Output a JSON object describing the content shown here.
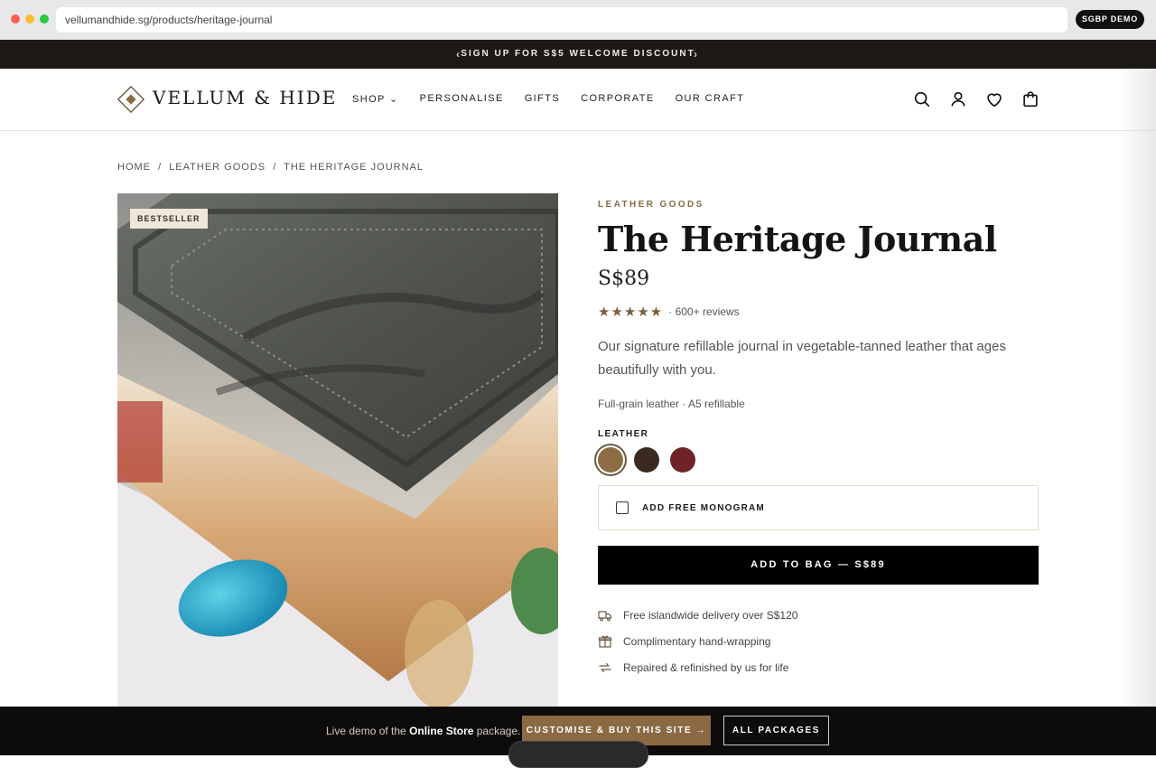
{
  "browser": {
    "url": "vellumandhide.sg/products/heritage-journal",
    "demo_badge": "SGBP DEMO"
  },
  "announcement": {
    "prev_arrow": "‹",
    "message": "SIGN UP FOR S$5 WELCOME DISCOUNT",
    "next_arrow": "›"
  },
  "header": {
    "logo": "VELLUM & HIDE",
    "nav": [
      "SHOP ⌄",
      "PERSONALISE",
      "GIFTS",
      "CORPORATE",
      "OUR CRAFT"
    ],
    "icons": [
      "search-icon",
      "account-icon",
      "wishlist-icon",
      "bag-icon"
    ]
  },
  "breadcrumb": [
    "HOME",
    "/",
    "LEATHER GOODS",
    "/",
    "THE HERITAGE JOURNAL"
  ],
  "product": {
    "badge": "BESTSELLER",
    "category": "LEATHER GOODS",
    "title": "The Heritage Journal",
    "price": "S$89",
    "stars": "★★★★★",
    "rating_value": 5,
    "reviews": "· 600+ reviews",
    "description": "Our signature refillable journal in vegetable-tanned leather that ages beautifully with you.",
    "specs": "Full-grain leather · A5 refillable",
    "leather_label": "LEATHER",
    "swatches": [
      {
        "name": "tan",
        "color": "#8b6c43",
        "selected": true
      },
      {
        "name": "dark-brown",
        "color": "#3a2a1f",
        "selected": false
      },
      {
        "name": "oxblood",
        "color": "#6e2328",
        "selected": false
      }
    ],
    "monogram_label": "ADD FREE MONOGRAM",
    "monogram_checked": false,
    "add_button": "ADD TO BAG — S$89",
    "perks": [
      {
        "icon": "truck-icon",
        "text": "Free islandwide delivery over S$120"
      },
      {
        "icon": "gift-icon",
        "text": "Complimentary hand-wrapping"
      },
      {
        "icon": "repair-icon",
        "text": "Repaired & refinished by us for life"
      }
    ]
  },
  "demobar": {
    "text_prefix": "Live demo of the ",
    "text_bold": "Online Store",
    "text_suffix": " package.",
    "cta_primary": "CUSTOMISE & BUY THIS SITE →",
    "cta_secondary": "ALL PACKAGES"
  },
  "colors": {
    "accent": "#8b6a43",
    "announce_bg": "#1d1915",
    "footer_bg": "#0e0c0a"
  }
}
